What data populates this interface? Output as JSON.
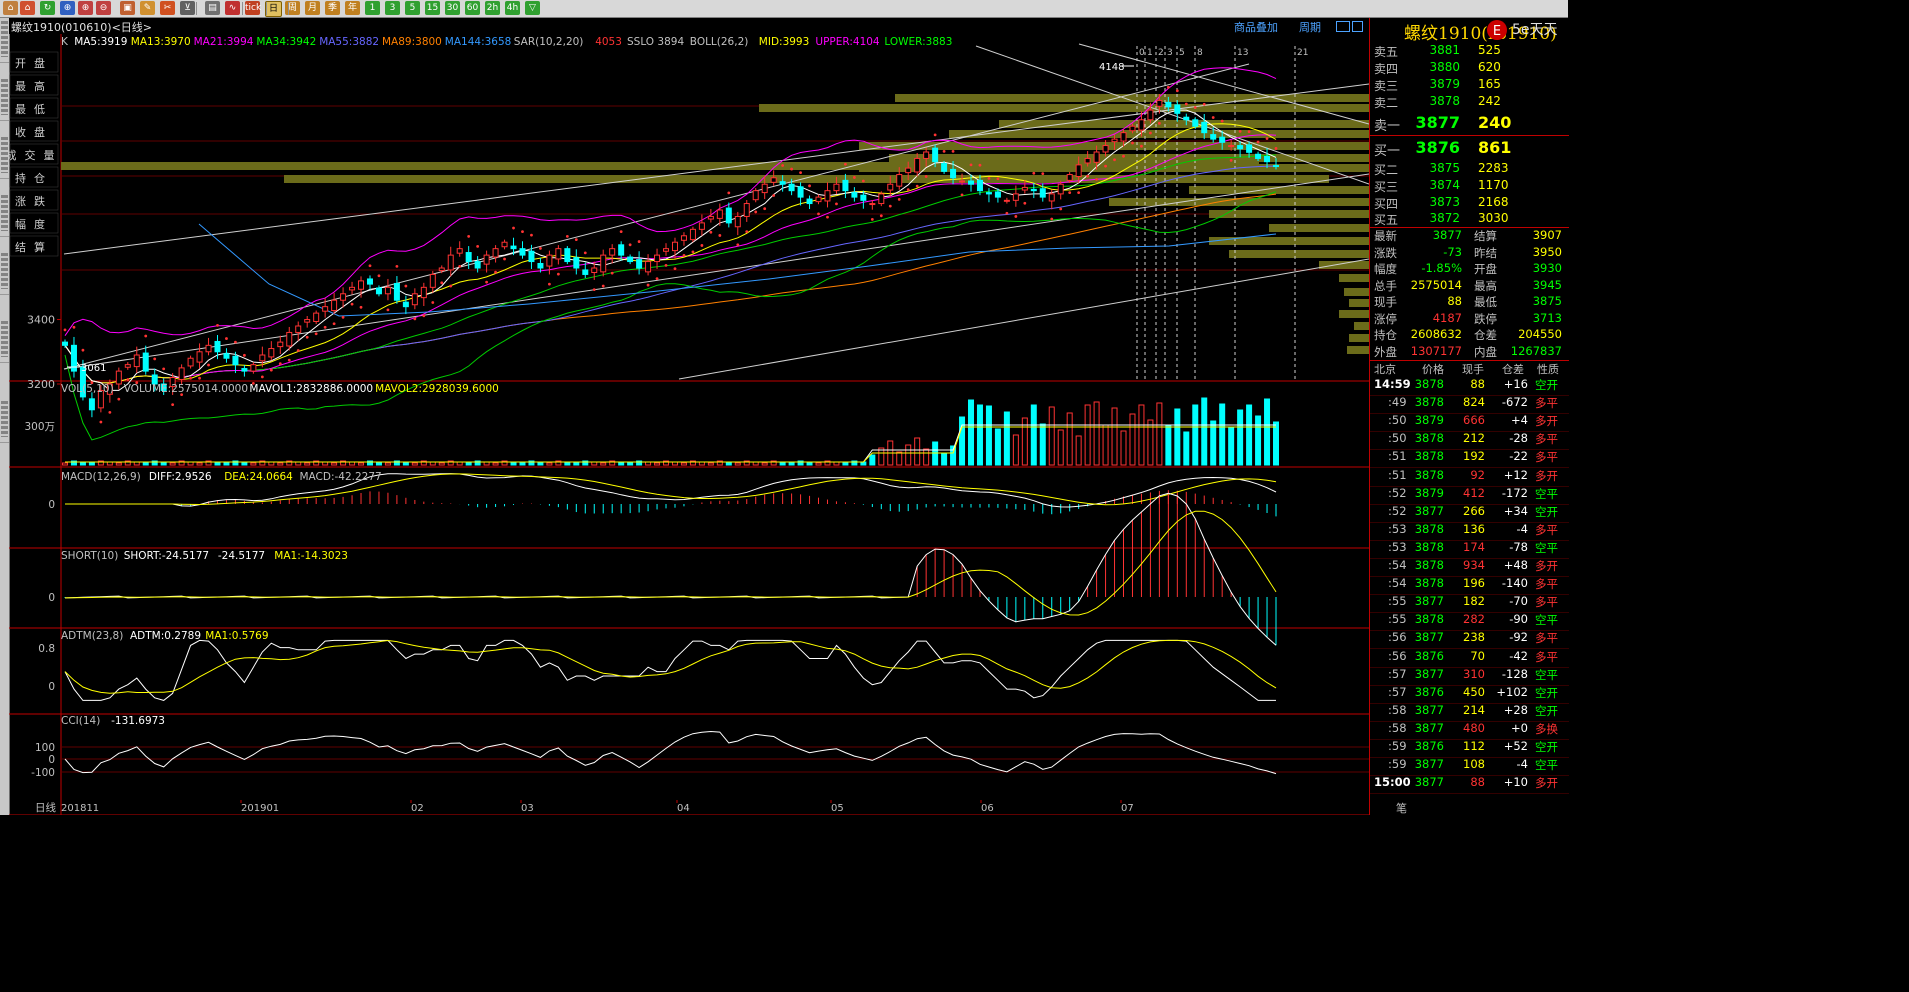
{
  "toolbar": {
    "items": [
      "home-icon",
      "back-icon",
      "refresh-icon",
      "search-icon",
      "zoom-in-icon",
      "zoom-out-icon",
      "window-icon",
      "pen-icon",
      "tool-icon",
      "filter-icon",
      "table-icon",
      "chart-icon",
      "tick-icon",
      "day-icon",
      "week-icon",
      "month-icon",
      "season-icon",
      "year-icon",
      "min1-icon",
      "min3-icon",
      "min5-icon",
      "min15-icon",
      "min30-icon",
      "min60-icon",
      "hour2-icon",
      "hour4-icon",
      "multi-icon"
    ],
    "labels": {
      "tick": "tick",
      "day": "日",
      "week": "周",
      "month": "月",
      "season": "季",
      "year": "年",
      "m1": "1",
      "m3": "3",
      "m5": "5",
      "m15": "15",
      "m30": "30",
      "m60": "60",
      "h2": "2h",
      "h4": "4h"
    }
  },
  "title": {
    "text": "螺纹1910(010610)<日线>",
    "overlay": "商品叠加",
    "period": "周期"
  },
  "left_tabs": [
    "分时走势",
    "技术分析",
    "基本资料",
    "财务数据",
    "画线工具",
    "自选股",
    "F10"
  ],
  "main": {
    "indicator_line": [
      {
        "t": "K",
        "c": "#c0c0c0"
      },
      {
        "t": "MA5:3919",
        "c": "#ffffff"
      },
      {
        "t": "MA13:3970",
        "c": "#ffff00"
      },
      {
        "t": "MA21:3994",
        "c": "#ff00ff"
      },
      {
        "t": "MA34:3942",
        "c": "#00ff00"
      },
      {
        "t": "MA55:3882",
        "c": "#6666ff"
      },
      {
        "t": "MA89:3800",
        "c": "#ff8000"
      },
      {
        "t": "MA144:3658",
        "c": "#3399ff"
      },
      {
        "t": "SAR(10,2,20)",
        "c": "#c0c0c0"
      },
      {
        "t": "4053",
        "c": "#ff3333"
      },
      {
        "t": "SSLO 3894",
        "c": "#c0c0c0"
      },
      {
        "t": "BOLL(26,2)",
        "c": "#c0c0c0"
      },
      {
        "t": "MID:3993",
        "c": "#ffff00"
      },
      {
        "t": "UPPER:4104",
        "c": "#ff00ff"
      },
      {
        "t": "LOWER:3883",
        "c": "#00ff00"
      }
    ],
    "side_labels": [
      "开盘",
      "最高",
      "最低",
      "收盘",
      "成交量",
      "持仓",
      "涨跌",
      "幅度",
      "结算"
    ],
    "yticks": [
      "3400",
      "3200"
    ],
    "high_label": "4148",
    "low_label": "3061",
    "top_numbers": [
      "0",
      "1",
      "2",
      "3",
      "5",
      "8",
      "13",
      "21"
    ],
    "dates": [
      "201811",
      "201901",
      "02",
      "03",
      "04",
      "05",
      "06",
      "07"
    ],
    "period_label": "日线"
  },
  "panels": {
    "vol": {
      "label": "VOL(5,10)",
      "volume": "VOLUME:2575014.0000",
      "m1": "MAVOL1:2832886.0000",
      "m2": "MAVOL2:2928039.6000",
      "ytick": "300万"
    },
    "macd": {
      "label": "MACD(12,26,9)",
      "diff": "DIFF:2.9526",
      "dea": "DEA:24.0664",
      "macd": "MACD:-42.2277",
      "ytick": "0"
    },
    "short": {
      "label": "SHORT(10)",
      "s": "SHORT:-24.5177",
      "s2": "-24.5177",
      "ma": "MA1:-14.3023",
      "ytick": "0"
    },
    "adtm": {
      "label": "ADTM(23,8)",
      "v": "ADTM:0.2789",
      "ma": "MA1:0.5769",
      "yticks": [
        "0.8",
        "0"
      ]
    },
    "cci": {
      "label": "CCI(14)",
      "v": "-131.6973",
      "yticks": [
        "100",
        "0",
        "-100"
      ]
    }
  },
  "chart_data": {
    "type": "candlestick",
    "title": "螺纹1910(010610)<日线>",
    "ylabel": "",
    "xlabel": "",
    "ylim": [
      3000,
      4200
    ],
    "x_tick_labels": [
      "201811",
      "201901",
      "02",
      "03",
      "04",
      "05",
      "06",
      "07"
    ],
    "closes": [
      3320,
      3240,
      3160,
      3120,
      3180,
      3200,
      3240,
      3260,
      3290,
      3240,
      3200,
      3180,
      3220,
      3250,
      3280,
      3300,
      3320,
      3300,
      3280,
      3260,
      3240,
      3260,
      3290,
      3310,
      3330,
      3360,
      3380,
      3400,
      3420,
      3440,
      3460,
      3480,
      3500,
      3520,
      3510,
      3480,
      3500,
      3460,
      3440,
      3480,
      3500,
      3540,
      3560,
      3600,
      3620,
      3580,
      3560,
      3600,
      3620,
      3640,
      3620,
      3600,
      3580,
      3560,
      3600,
      3620,
      3580,
      3560,
      3540,
      3560,
      3600,
      3620,
      3600,
      3580,
      3560,
      3580,
      3600,
      3620,
      3640,
      3660,
      3680,
      3700,
      3720,
      3740,
      3700,
      3720,
      3760,
      3800,
      3820,
      3840,
      3820,
      3800,
      3780,
      3760,
      3780,
      3800,
      3820,
      3800,
      3780,
      3770,
      3760,
      3790,
      3820,
      3850,
      3870,
      3900,
      3920,
      3890,
      3860,
      3840,
      3830,
      3820,
      3800,
      3790,
      3780,
      3770,
      3790,
      3810,
      3800,
      3780,
      3790,
      3820,
      3850,
      3880,
      3900,
      3920,
      3940,
      3960,
      3980,
      4000,
      4020,
      4050,
      4080,
      4060,
      4040,
      4020,
      4000,
      3980,
      3960,
      3950,
      3940,
      3930,
      3919,
      3900,
      3890,
      3877
    ],
    "axis_ticks": [
      "3400",
      "3200"
    ],
    "high": 4148,
    "low": 3061,
    "fib_days": [
      "0",
      "1",
      "2",
      "3",
      "5",
      "8",
      "13",
      "21"
    ],
    "ma": {
      "MA5": 3919,
      "MA13": 3970,
      "MA21": 3994,
      "MA34": 3942,
      "MA55": 3882,
      "MA89": 3800,
      "MA144": 3658
    },
    "boll": {
      "mid": 3993,
      "upper": 4104,
      "lower": 3883
    },
    "sar": 4053,
    "volume_last": 2575014,
    "series": [
      {
        "name": "MA5",
        "values": [
          3919
        ]
      },
      {
        "name": "MA13",
        "values": [
          3970
        ]
      },
      {
        "name": "MA21",
        "values": [
          3994
        ]
      },
      {
        "name": "MA34",
        "values": [
          3942
        ]
      },
      {
        "name": "MA55",
        "values": [
          3882
        ]
      },
      {
        "name": "MA89",
        "values": [
          3800
        ]
      },
      {
        "name": "MA144",
        "values": [
          3658
        ]
      }
    ]
  },
  "right": {
    "name": "螺纹1910(rb1910)",
    "logo": "5e天天",
    "asks": [
      {
        "l": "卖五",
        "p": "3881",
        "v": "525"
      },
      {
        "l": "卖四",
        "p": "3880",
        "v": "620"
      },
      {
        "l": "卖三",
        "p": "3879",
        "v": "165"
      },
      {
        "l": "卖二",
        "p": "3878",
        "v": "242"
      },
      {
        "l": "卖一",
        "p": "3877",
        "v": "240"
      }
    ],
    "bids": [
      {
        "l": "买一",
        "p": "3876",
        "v": "861"
      },
      {
        "l": "买二",
        "p": "3875",
        "v": "2283"
      },
      {
        "l": "买三",
        "p": "3874",
        "v": "1170"
      },
      {
        "l": "买四",
        "p": "3873",
        "v": "2168"
      },
      {
        "l": "买五",
        "p": "3872",
        "v": "3030"
      }
    ],
    "stats": [
      {
        "l1": "最新",
        "v1": "3877",
        "c1": "#00ff00",
        "l2": "结算",
        "v2": "3907",
        "c2": "#ffff00"
      },
      {
        "l1": "涨跌",
        "v1": "-73",
        "c1": "#00ff00",
        "l2": "昨结",
        "v2": "3950",
        "c2": "#ffff00"
      },
      {
        "l1": "幅度",
        "v1": "-1.85%",
        "c1": "#00ff00",
        "l2": "开盘",
        "v2": "3930",
        "c2": "#00ff00"
      },
      {
        "l1": "总手",
        "v1": "2575014",
        "c1": "#ffff00",
        "l2": "最高",
        "v2": "3945",
        "c2": "#00ff00"
      },
      {
        "l1": "现手",
        "v1": "88",
        "c1": "#ffff00",
        "l2": "最低",
        "v2": "3875",
        "c2": "#00ff00"
      },
      {
        "l1": "涨停",
        "v1": "4187",
        "c1": "#ff3333",
        "l2": "跌停",
        "v2": "3713",
        "c2": "#00ff00"
      },
      {
        "l1": "持仓",
        "v1": "2608632",
        "c1": "#ffff00",
        "l2": "仓差",
        "v2": "204550",
        "c2": "#ffff00"
      },
      {
        "l1": "外盘",
        "v1": "1307177",
        "c1": "#ff3333",
        "l2": "内盘",
        "v2": "1267837",
        "c2": "#00ff00"
      }
    ],
    "tick_header": {
      "time": "北京",
      "price": "价格",
      "vol": "现手",
      "oi": "仓差",
      "nature": "性质"
    },
    "ticks": [
      {
        "t": "14:59",
        "p": "3878",
        "v": "88",
        "vc": "#ffff00",
        "oi": "+16",
        "oc": "#ffffff",
        "n": "空开",
        "nc": "#00ff00"
      },
      {
        "t": ":49",
        "p": "3878",
        "v": "824",
        "vc": "#ffff00",
        "oi": "-672",
        "oc": "#ffffff",
        "n": "多平",
        "nc": "#ff3333"
      },
      {
        "t": ":50",
        "p": "3879",
        "v": "666",
        "vc": "#ff3333",
        "oi": "+4",
        "oc": "#ffffff",
        "n": "多开",
        "nc": "#ff3333"
      },
      {
        "t": ":50",
        "p": "3878",
        "v": "212",
        "vc": "#ffff00",
        "oi": "-28",
        "oc": "#ffffff",
        "n": "多平",
        "nc": "#ff3333"
      },
      {
        "t": ":51",
        "p": "3878",
        "v": "192",
        "vc": "#ffff00",
        "oi": "-22",
        "oc": "#ffffff",
        "n": "多平",
        "nc": "#ff3333"
      },
      {
        "t": ":51",
        "p": "3878",
        "v": "92",
        "vc": "#ff3333",
        "oi": "+12",
        "oc": "#ffffff",
        "n": "多开",
        "nc": "#ff3333"
      },
      {
        "t": ":52",
        "p": "3879",
        "v": "412",
        "vc": "#ff3333",
        "oi": "-172",
        "oc": "#ffffff",
        "n": "空平",
        "nc": "#00ff00"
      },
      {
        "t": ":52",
        "p": "3877",
        "v": "266",
        "vc": "#ffff00",
        "oi": "+34",
        "oc": "#ffffff",
        "n": "空开",
        "nc": "#00ff00"
      },
      {
        "t": ":53",
        "p": "3878",
        "v": "136",
        "vc": "#ffff00",
        "oi": "-4",
        "oc": "#ffffff",
        "n": "多平",
        "nc": "#ff3333"
      },
      {
        "t": ":53",
        "p": "3878",
        "v": "174",
        "vc": "#ff3333",
        "oi": "-78",
        "oc": "#ffffff",
        "n": "空平",
        "nc": "#00ff00"
      },
      {
        "t": ":54",
        "p": "3878",
        "v": "934",
        "vc": "#ff3333",
        "oi": "+48",
        "oc": "#ffffff",
        "n": "多开",
        "nc": "#ff3333"
      },
      {
        "t": ":54",
        "p": "3878",
        "v": "196",
        "vc": "#ffff00",
        "oi": "-140",
        "oc": "#ffffff",
        "n": "多平",
        "nc": "#ff3333"
      },
      {
        "t": ":55",
        "p": "3877",
        "v": "182",
        "vc": "#ffff00",
        "oi": "-70",
        "oc": "#ffffff",
        "n": "多平",
        "nc": "#ff3333"
      },
      {
        "t": ":55",
        "p": "3878",
        "v": "282",
        "vc": "#ff3333",
        "oi": "-90",
        "oc": "#ffffff",
        "n": "空平",
        "nc": "#00ff00"
      },
      {
        "t": ":56",
        "p": "3877",
        "v": "238",
        "vc": "#ffff00",
        "oi": "-92",
        "oc": "#ffffff",
        "n": "多平",
        "nc": "#ff3333"
      },
      {
        "t": ":56",
        "p": "3876",
        "v": "70",
        "vc": "#ffff00",
        "oi": "-42",
        "oc": "#ffffff",
        "n": "多平",
        "nc": "#ff3333"
      },
      {
        "t": ":57",
        "p": "3877",
        "v": "310",
        "vc": "#ff3333",
        "oi": "-128",
        "oc": "#ffffff",
        "n": "空平",
        "nc": "#00ff00"
      },
      {
        "t": ":57",
        "p": "3876",
        "v": "450",
        "vc": "#ffff00",
        "oi": "+102",
        "oc": "#ffffff",
        "n": "空开",
        "nc": "#00ff00"
      },
      {
        "t": ":58",
        "p": "3877",
        "v": "214",
        "vc": "#ffff00",
        "oi": "+28",
        "oc": "#ffffff",
        "n": "空开",
        "nc": "#00ff00"
      },
      {
        "t": ":58",
        "p": "3877",
        "v": "480",
        "vc": "#ff3333",
        "oi": "+0",
        "oc": "#ffffff",
        "n": "多换",
        "nc": "#ff3333"
      },
      {
        "t": ":59",
        "p": "3876",
        "v": "112",
        "vc": "#ffff00",
        "oi": "+52",
        "oc": "#ffffff",
        "n": "空开",
        "nc": "#00ff00"
      },
      {
        "t": ":59",
        "p": "3877",
        "v": "108",
        "vc": "#ffff00",
        "oi": "-4",
        "oc": "#ffffff",
        "n": "空平",
        "nc": "#00ff00"
      },
      {
        "t": "15:00",
        "p": "3877",
        "v": "88",
        "vc": "#ff3333",
        "oi": "+10",
        "oc": "#ffffff",
        "n": "多开",
        "nc": "#ff3333"
      }
    ],
    "bottom": "笔"
  }
}
